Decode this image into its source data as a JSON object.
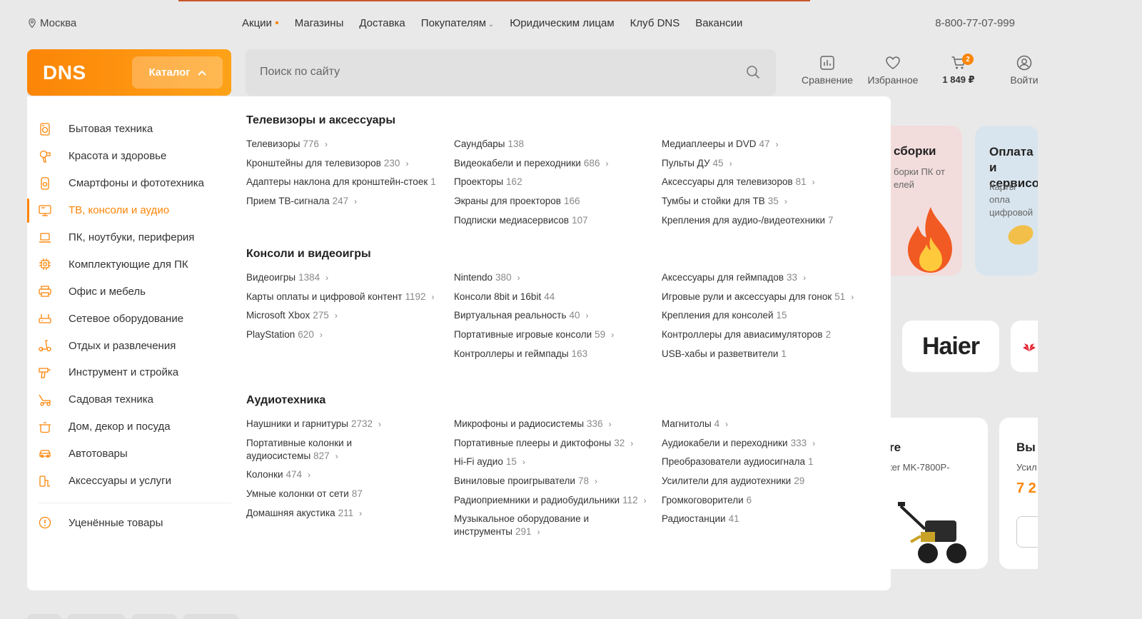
{
  "topnav": {
    "city": "Москва",
    "links": [
      "Акции",
      "Магазины",
      "Доставка",
      "Покупателям",
      "Юридическим лицам",
      "Клуб DNS",
      "Вакансии"
    ],
    "phone": "8-800-77-07-999"
  },
  "header": {
    "logo": "DNS",
    "catalog_label": "Каталог",
    "search_placeholder": "Поиск по сайту",
    "compare_label": "Сравнение",
    "favorites_label": "Избранное",
    "cart_price": "1 849 ₽",
    "cart_count": "2",
    "login_label": "Войти"
  },
  "colors": {
    "accent": "#fc8507",
    "panel": "#ffffff",
    "background": "#e9e9e9"
  },
  "sidebar": {
    "items": [
      {
        "label": "Бытовая техника",
        "icon": "appliance-icon"
      },
      {
        "label": "Красота и здоровье",
        "icon": "hairdryer-icon"
      },
      {
        "label": "Смартфоны и фототехника",
        "icon": "smartphone-icon"
      },
      {
        "label": "ТВ, консоли и аудио",
        "icon": "tv-icon",
        "active": true
      },
      {
        "label": "ПК, ноутбуки, периферия",
        "icon": "laptop-icon"
      },
      {
        "label": "Комплектующие для ПК",
        "icon": "chip-icon"
      },
      {
        "label": "Офис и мебель",
        "icon": "printer-icon"
      },
      {
        "label": "Сетевое оборудование",
        "icon": "router-icon"
      },
      {
        "label": "Отдых и развлечения",
        "icon": "scooter-icon"
      },
      {
        "label": "Инструмент и стройка",
        "icon": "drill-icon"
      },
      {
        "label": "Садовая техника",
        "icon": "mower-icon"
      },
      {
        "label": "Дом, декор и посуда",
        "icon": "pot-icon"
      },
      {
        "label": "Автотовары",
        "icon": "car-icon"
      },
      {
        "label": "Аксессуары и услуги",
        "icon": "accessory-icon"
      }
    ],
    "sale_label": "Уценённые товары"
  },
  "sections": [
    {
      "title": "Телевизоры и аксессуары",
      "columns": [
        [
          {
            "name": "Телевизоры",
            "count": "776",
            "arrow": true
          },
          {
            "name": "Кронштейны для телевизоров",
            "count": "230",
            "arrow": true
          },
          {
            "name": "Адаптеры наклона для кронштейн-стоек",
            "count": "1",
            "arrow": false
          },
          {
            "name": "Прием ТВ-сигнала",
            "count": "247",
            "arrow": true
          }
        ],
        [
          {
            "name": "Саундбары",
            "count": "138",
            "arrow": false
          },
          {
            "name": "Видеокабели и переходники",
            "count": "686",
            "arrow": true
          },
          {
            "name": "Проекторы",
            "count": "162",
            "arrow": false
          },
          {
            "name": "Экраны для проекторов",
            "count": "166",
            "arrow": false
          },
          {
            "name": "Подписки медиасервисов",
            "count": "107",
            "arrow": false
          }
        ],
        [
          {
            "name": "Медиаплееры и DVD",
            "count": "47",
            "arrow": true
          },
          {
            "name": "Пульты ДУ",
            "count": "45",
            "arrow": true
          },
          {
            "name": "Аксессуары для телевизоров",
            "count": "81",
            "arrow": true
          },
          {
            "name": "Тумбы и стойки для ТВ",
            "count": "35",
            "arrow": true
          },
          {
            "name": "Крепления для аудио-/видеотехники",
            "count": "7",
            "arrow": false
          }
        ]
      ]
    },
    {
      "title": "Консоли и видеоигры",
      "columns": [
        [
          {
            "name": "Видеоигры",
            "count": "1384",
            "arrow": true
          },
          {
            "name": "Карты оплаты и цифровой контент",
            "count": "1192",
            "arrow": true
          },
          {
            "name": "Microsoft Xbox",
            "count": "275",
            "arrow": true
          },
          {
            "name": "PlayStation",
            "count": "620",
            "arrow": true
          }
        ],
        [
          {
            "name": "Nintendo",
            "count": "380",
            "arrow": true
          },
          {
            "name": "Консоли 8bit и 16bit",
            "count": "44",
            "arrow": false
          },
          {
            "name": "Виртуальная реальность",
            "count": "40",
            "arrow": true
          },
          {
            "name": "Портативные игровые консоли",
            "count": "59",
            "arrow": true
          },
          {
            "name": "Контроллеры и геймпады",
            "count": "163",
            "arrow": false
          }
        ],
        [
          {
            "name": "Аксессуары для геймпадов",
            "count": "33",
            "arrow": true
          },
          {
            "name": "Игровые рули и аксессуары для гонок",
            "count": "51",
            "arrow": true
          },
          {
            "name": "Крепления для консолей",
            "count": "15",
            "arrow": false
          },
          {
            "name": "Контроллеры для авиасимуляторов",
            "count": "2",
            "arrow": false
          },
          {
            "name": "USB-хабы и разветвители",
            "count": "1",
            "arrow": false
          }
        ]
      ]
    },
    {
      "title": "Аудиотехника",
      "columns": [
        [
          {
            "name": "Наушники и гарнитуры",
            "count": "2732",
            "arrow": true
          },
          {
            "name": "Портативные колонки и аудиосистемы",
            "count": "827",
            "arrow": true
          },
          {
            "name": "Колонки",
            "count": "474",
            "arrow": true
          },
          {
            "name": "Умные колонки от сети",
            "count": "87",
            "arrow": false
          },
          {
            "name": "Домашняя акустика",
            "count": "211",
            "arrow": true
          }
        ],
        [
          {
            "name": "Микрофоны и радиосистемы",
            "count": "336",
            "arrow": true
          },
          {
            "name": "Портативные плееры и диктофоны",
            "count": "32",
            "arrow": true
          },
          {
            "name": "Hi-Fi аудио",
            "count": "15",
            "arrow": true
          },
          {
            "name": "Виниловые проигрыватели",
            "count": "78",
            "arrow": true
          },
          {
            "name": "Радиоприемники и радиобудильники",
            "count": "112",
            "arrow": true
          },
          {
            "name": "Музыкальное оборудование и инструменты",
            "count": "291",
            "arrow": true
          }
        ],
        [
          {
            "name": "Магнитолы",
            "count": "4",
            "arrow": true
          },
          {
            "name": "Аудиокабели и переходники",
            "count": "333",
            "arrow": true
          },
          {
            "name": "Преобразователи аудиосигнала",
            "count": "1",
            "arrow": false
          },
          {
            "name": "Усилители для аудиотехники",
            "count": "29",
            "arrow": false
          },
          {
            "name": "Громкоговорители",
            "count": "6",
            "arrow": false
          },
          {
            "name": "Радиостанции",
            "count": "41",
            "arrow": false
          }
        ]
      ]
    }
  ],
  "background": {
    "promo1_title": "сборки",
    "promo1_text": "борки ПК от елей",
    "promo2_title": "Оплата и сервисо",
    "promo2_text": "Карты опла цифровой",
    "brand": "Haier",
    "product1_title": "re",
    "product1_text": "ter MK-7800P-",
    "product2_title": "Вы",
    "product2_text": "Усил",
    "product2_price": "7 2"
  }
}
